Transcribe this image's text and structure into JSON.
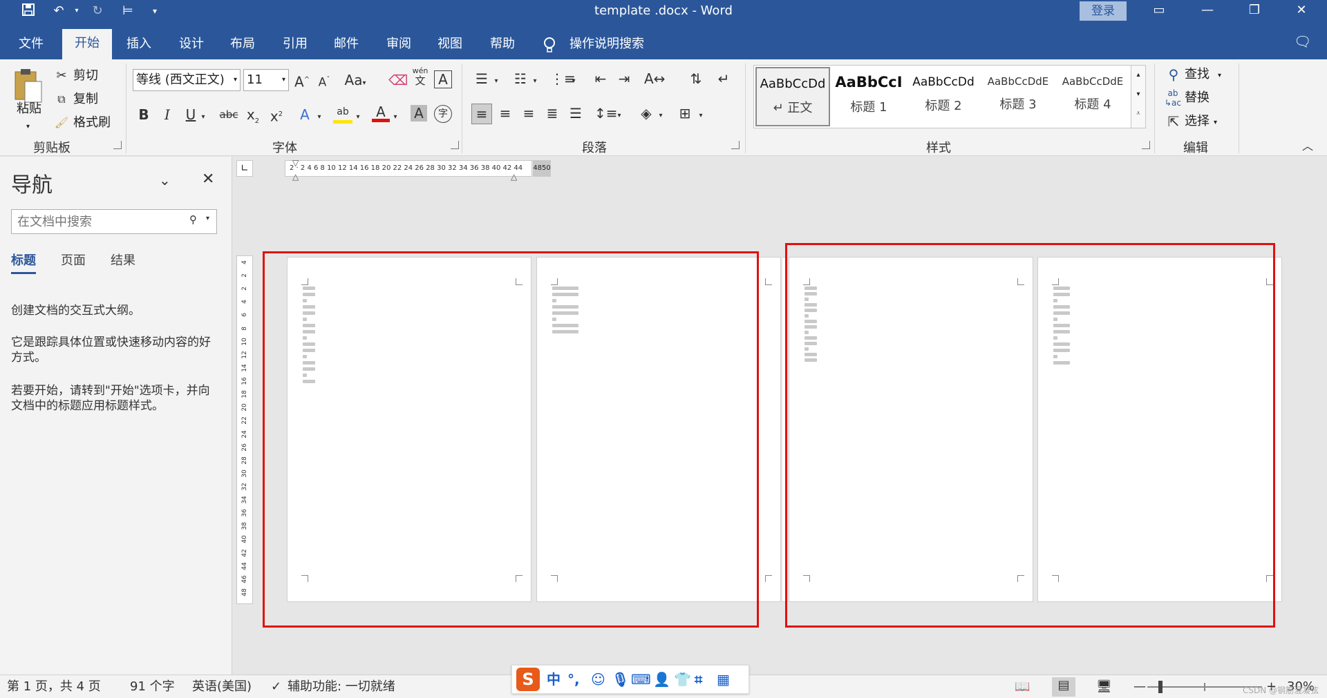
{
  "window": {
    "title": "template .docx  -  Word",
    "login_label": "登录",
    "quick_access": [
      "save-icon",
      "undo-icon",
      "redo-icon",
      "touch-mode-icon",
      "customize-icon"
    ]
  },
  "tabs": {
    "file": "文件",
    "home": "开始",
    "insert": "插入",
    "design": "设计",
    "layout": "布局",
    "references": "引用",
    "mailings": "邮件",
    "review": "审阅",
    "view": "视图",
    "help": "帮助",
    "tell_me": "操作说明搜索",
    "active": "开始"
  },
  "clipboard": {
    "paste": "粘贴",
    "cut": "剪切",
    "copy": "复制",
    "format_painter": "格式刷",
    "label": "剪贴板"
  },
  "font": {
    "name": "等线 (西文正文)",
    "size": "11",
    "label": "字体",
    "grow": "A",
    "shrink": "A",
    "change_case": "Aa",
    "bold": "B",
    "italic": "I",
    "underline": "U",
    "strike": "abc",
    "subscript": "x",
    "superscript": "x",
    "phonetic_top": "wén",
    "phonetic_bottom": "文",
    "char_border": "A",
    "effects": "A",
    "highlight": "ab",
    "font_color": "A",
    "shading": "A",
    "enclose": "字"
  },
  "paragraph": {
    "label": "段落"
  },
  "styles": {
    "label": "样式",
    "items": [
      {
        "sample": "AaBbCcDd",
        "name": "正文",
        "prefix": "↵"
      },
      {
        "sample": "AaBbCcI",
        "name": "标题 1"
      },
      {
        "sample": "AaBbCcDd",
        "name": "标题 2"
      },
      {
        "sample": "AaBbCcDdE",
        "name": "标题 3"
      },
      {
        "sample": "AaBbCcDdE",
        "name": "标题 4"
      }
    ]
  },
  "editing": {
    "find": "查找",
    "replace": "替换",
    "select": "选择",
    "label": "编辑"
  },
  "nav": {
    "title": "导航",
    "search_placeholder": "在文档中搜索",
    "tabs": [
      "标题",
      "页面",
      "结果"
    ],
    "p1": "创建文档的交互式大纲。",
    "p2": "它是跟踪具体位置或快速移动内容的好方式。",
    "p3": "若要开始，请转到\"开始\"选项卡，并向文档中的标题应用标题样式。"
  },
  "ruler": {
    "horizontal": "2 · 2 4 6 8 10 12 14 16 18 20 22 24 26 28 30 32 34 36 38 40 42 44",
    "horizontal_end": "4850",
    "vertical": [
      "4",
      "2",
      "2",
      "4",
      "6",
      "8",
      "10",
      "12",
      "14",
      "16",
      "18",
      "20",
      "22",
      "24",
      "26",
      "28",
      "30",
      "32",
      "34",
      "36",
      "38",
      "40",
      "42",
      "44",
      "46",
      "48"
    ]
  },
  "status": {
    "page": "第 1 页，共 4 页",
    "words": "91 个字",
    "language": "英语(美国)",
    "accessibility": "辅助功能: 一切就绪",
    "zoom": "30%",
    "watermark": "CSDN @钢筋混凝弦"
  },
  "ime": {
    "logo": "S",
    "mode": "中",
    "punct": "°,"
  },
  "colors": {
    "title_blue": "#2b579a",
    "annotation_red": "#e01010",
    "highlight_yellow": "#ffe600",
    "font_red": "#e01010"
  }
}
